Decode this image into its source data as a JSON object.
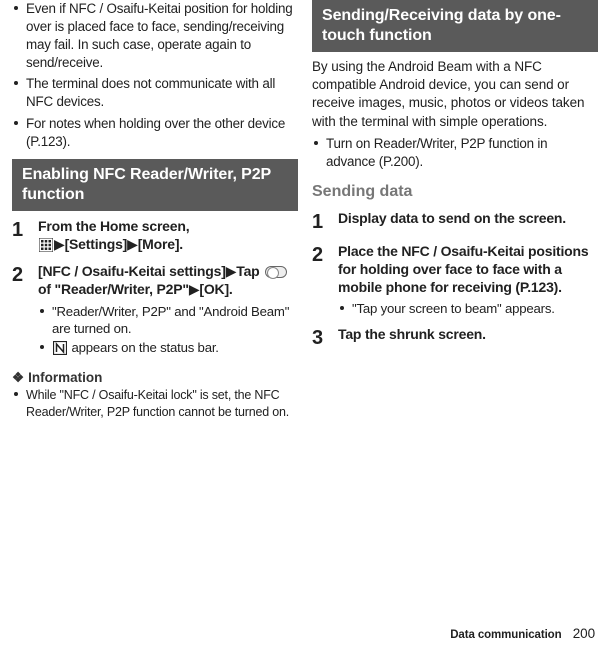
{
  "left": {
    "bullets": [
      "Even if NFC / Osaifu-Keitai position for holding over is placed face to face, sending/receiving may fail. In such case, operate again to send/receive.",
      "The terminal does not communicate with all NFC devices.",
      "For notes when holding over the other device (P.123)."
    ],
    "section_header": "Enabling NFC Reader/Writer, P2P function",
    "step1_line": "From the Home screen,",
    "step1_line2a": "[Settings]",
    "step1_line2b": "[More].",
    "step2_a": "[NFC / Osaifu-Keitai settings]",
    "step2_b": "Tap",
    "step2_c": " of \"Reader/Writer, P2P\"",
    "step2_d": "[OK].",
    "step2_sub": [
      "\"Reader/Writer, P2P\" and \"Android Beam\" are turned on.",
      " appears on the status bar."
    ],
    "info_heading": "Information",
    "info_items": [
      "While \"NFC / Osaifu-Keitai lock\" is set, the NFC Reader/Writer, P2P function cannot be turned on."
    ]
  },
  "right": {
    "section_header": "Sending/Receiving data by one-touch function",
    "intro": "By using the Android Beam with a NFC compatible Android device, you can send or receive images, music, photos or videos taken with the terminal with simple operations.",
    "intro_bullets": [
      "Turn on Reader/Writer, P2P function in advance (P.200)."
    ],
    "sub_heading": "Sending data",
    "step1": "Display data to send on the screen.",
    "step2": "Place the NFC / Osaifu-Keitai positions for holding over face to face with a mobile phone for receiving (P.123).",
    "step2_sub": [
      "\"Tap your screen to beam\" appears."
    ],
    "step3": "Tap the shrunk screen."
  },
  "footer": {
    "section": "Data communication",
    "page": "200"
  }
}
